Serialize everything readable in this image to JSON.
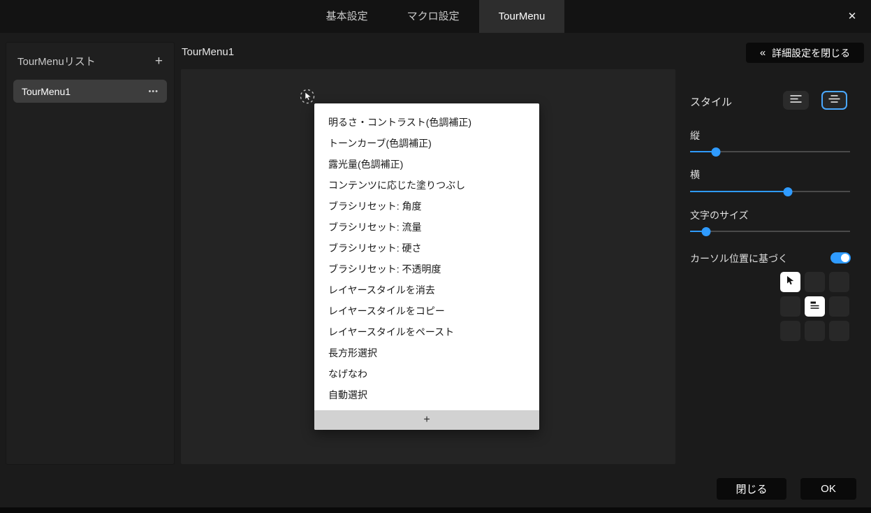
{
  "window": {
    "tabs": [
      {
        "label": "基本設定"
      },
      {
        "label": "マクロ設定"
      },
      {
        "label": "TourMenu"
      }
    ],
    "active_tab": "TourMenu"
  },
  "icons": {
    "close": "✕",
    "collapse": "«",
    "more": "•••",
    "add": "+"
  },
  "sidebar": {
    "title": "TourMenuリスト",
    "items": [
      {
        "label": "TourMenu1",
        "selected": true
      }
    ]
  },
  "main": {
    "title": "TourMenu1",
    "menu_items": [
      "明るさ・コントラスト(色調補正)",
      "トーンカーブ(色調補正)",
      "露光量(色調補正)",
      "コンテンツに応じた塗りつぶし",
      "ブラシリセット: 角度",
      "ブラシリセット: 流量",
      "ブラシリセット: 硬さ",
      "ブラシリセット: 不透明度",
      "レイヤースタイルを消去",
      "レイヤースタイルをコピー",
      "レイヤースタイルをペースト",
      "長方形選択",
      "なげなわ",
      "自動選択"
    ],
    "add_label": "+"
  },
  "settings": {
    "collapse_label": "詳細設定を閉じる",
    "style_label": "スタイル",
    "sliders": [
      {
        "label": "縦",
        "value": 16
      },
      {
        "label": "横",
        "value": 61
      },
      {
        "label": "文字のサイズ",
        "value": 10
      }
    ],
    "cursor_label": "カーソル位置に基づく",
    "cursor_enabled": true,
    "grid_cells": [
      "cursor-pointer",
      "",
      "",
      "",
      "menu-lines",
      "",
      "",
      "",
      ""
    ]
  },
  "footer": {
    "close": "閉じる",
    "ok": "OK"
  },
  "colors": {
    "accent": "#2f9bff"
  }
}
